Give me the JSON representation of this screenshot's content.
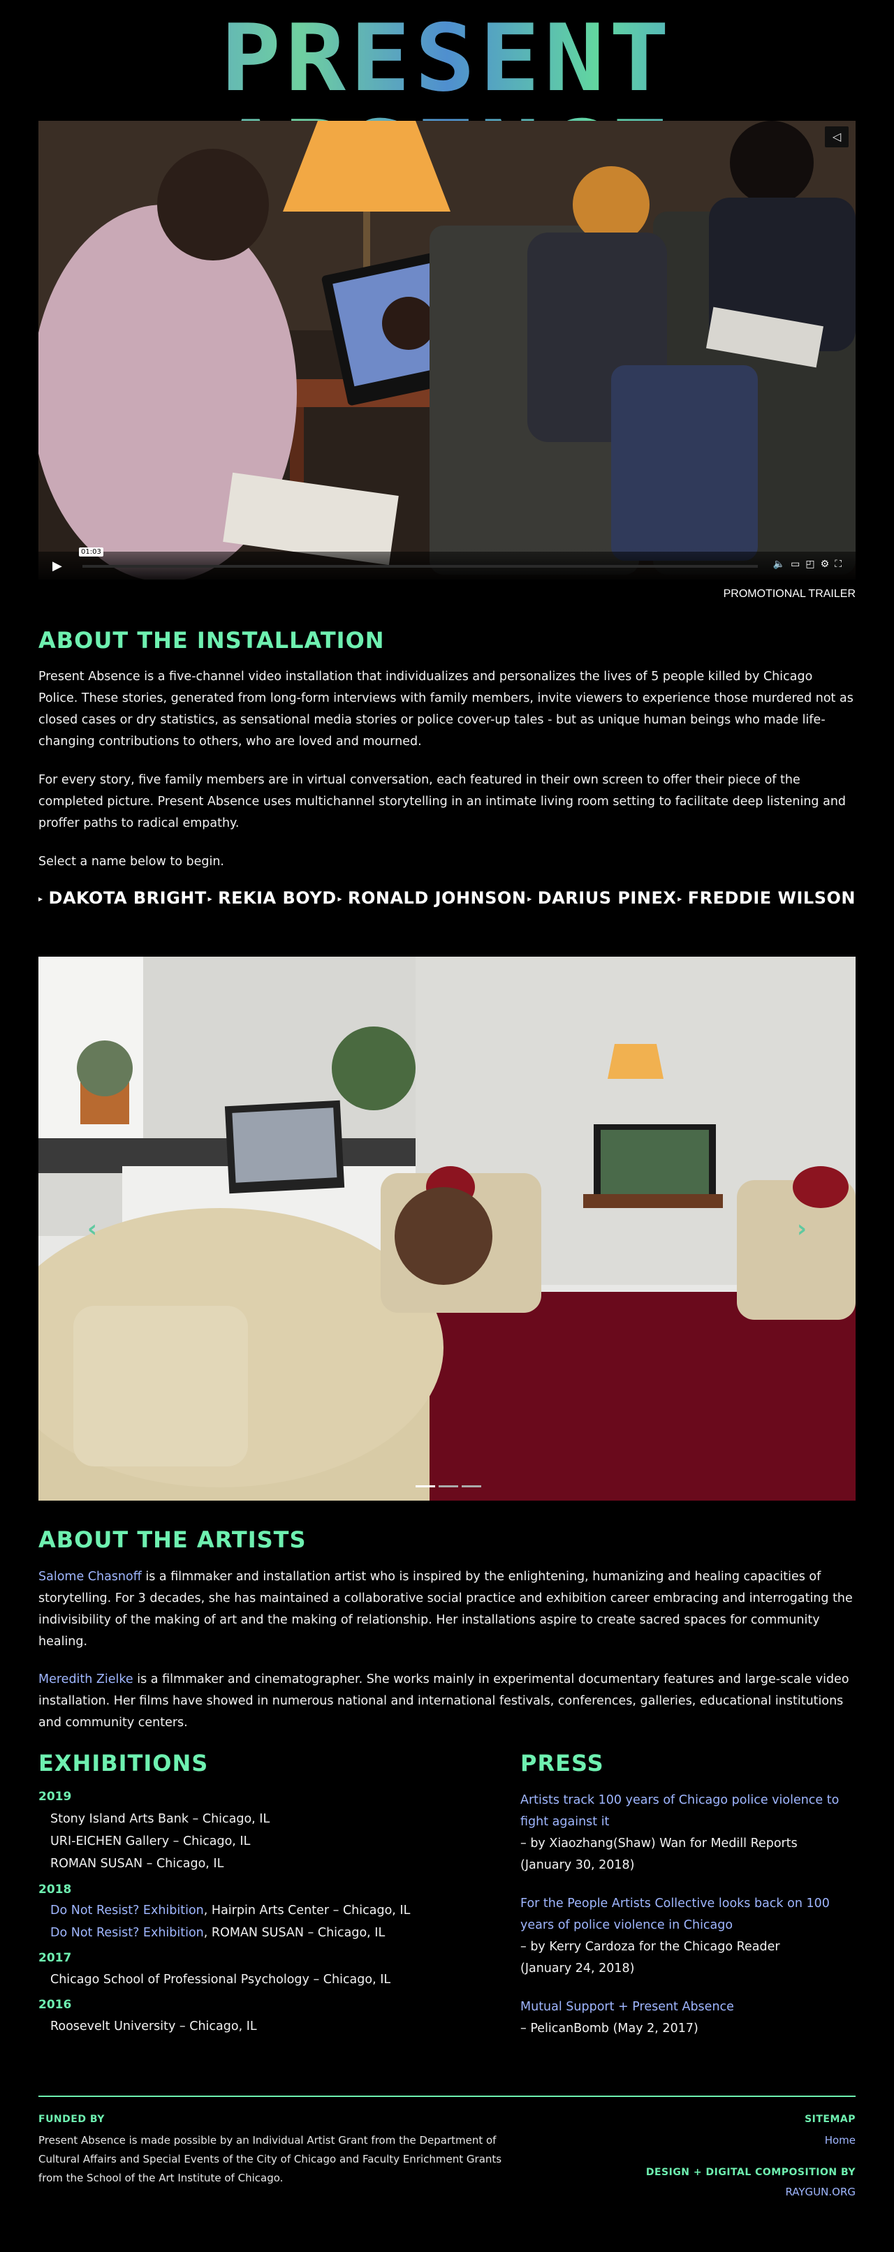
{
  "site_title": "PRESENT ABSENCE",
  "video": {
    "time": "01:03",
    "caption": "PROMOTIONAL TRAILER"
  },
  "about_installation": {
    "heading": "ABOUT THE INSTALLATION",
    "p1": "Present Absence is a five-channel video installation that individualizes and personalizes the lives of 5 people killed by Chicago Police. These stories, generated from long-form interviews with family members, invite viewers to experience those murdered not as closed cases or dry statistics, as sensational media stories or police cover-up tales - but as unique human beings who made life-changing contributions to others, who are loved and mourned.",
    "p2": "For every story, five family members are in virtual conversation, each featured in their own screen to offer their piece of the completed picture. Present Absence uses multichannel storytelling in an intimate living room setting to facilitate deep listening and proffer paths to radical empathy.",
    "prompt": "Select a name below to begin."
  },
  "names": [
    "DAKOTA BRIGHT",
    "REKIA BOYD",
    "RONALD JOHNSON",
    "DARIUS PINEX",
    "FREDDIE WILSON"
  ],
  "carousel": {
    "slides": 3,
    "active": 0
  },
  "about_artists": {
    "heading": "ABOUT THE ARTISTS",
    "artist1_name": "Salome Chasnoff",
    "artist1_bio": " is a filmmaker and installation artist who is inspired by the enlightening, humanizing and healing capacities of storytelling. For 3 decades, she has maintained a collaborative social practice and exhibition career embracing and interrogating the indivisibility of the making of art and the making of relationship. Her installations aspire to create sacred spaces for community healing.",
    "artist2_name": "Meredith Zielke",
    "artist2_bio": " is a filmmaker and cinematographer. She works mainly in experimental documentary features and large-scale video installation. Her films have showed in numerous national and international festivals, conferences, galleries, educational institutions and community centers."
  },
  "exhibitions": {
    "heading": "EXHIBITIONS",
    "y2019": "2019",
    "e2019": [
      "Stony Island Arts Bank – Chicago, IL",
      "URI-EICHEN Gallery – Chicago, IL",
      "ROMAN SUSAN – Chicago, IL"
    ],
    "y2018": "2018",
    "e2018_link": "Do Not Resist? Exhibition",
    "e2018_a": ", Hairpin Arts Center – Chicago, IL",
    "e2018_b": ", ROMAN SUSAN – Chicago, IL",
    "y2017": "2017",
    "e2017": "Chicago School of Professional Psychology – Chicago, IL",
    "y2016": "2016",
    "e2016": "Roosevelt University – Chicago, IL"
  },
  "press": {
    "heading": "PRESS",
    "items": [
      {
        "title": "Artists track 100 years of Chicago police violence to fight against it",
        "byline": "– by Xiaozhang(Shaw) Wan for Medill Reports",
        "date": "(January 30, 2018)"
      },
      {
        "title": "For the People Artists Collective looks back on 100 years of police violence in Chicago",
        "byline": "– by Kerry Cardoza for the Chicago Reader",
        "date": "(January 24, 2018)"
      },
      {
        "title": "Mutual Support + Present Absence",
        "byline": "– PelicanBomb (May 2, 2017)"
      }
    ]
  },
  "footer": {
    "funded_heading": "FUNDED BY",
    "funded_text": "Present Absence is made possible by an Individual Artist Grant from the Department of Cultural Affairs and Special Events of the City of Chicago and Faculty Enrichment Grants from the School of the Art Institute of Chicago.",
    "sitemap_heading": "SITEMAP",
    "home": "Home",
    "design_heading": "DESIGN + DIGITAL COMPOSITION BY",
    "design_link": "RAYGUN.ORG"
  },
  "colors": {
    "accent": "#6ef0b0",
    "link": "#9fb6ff",
    "background": "#000000"
  }
}
